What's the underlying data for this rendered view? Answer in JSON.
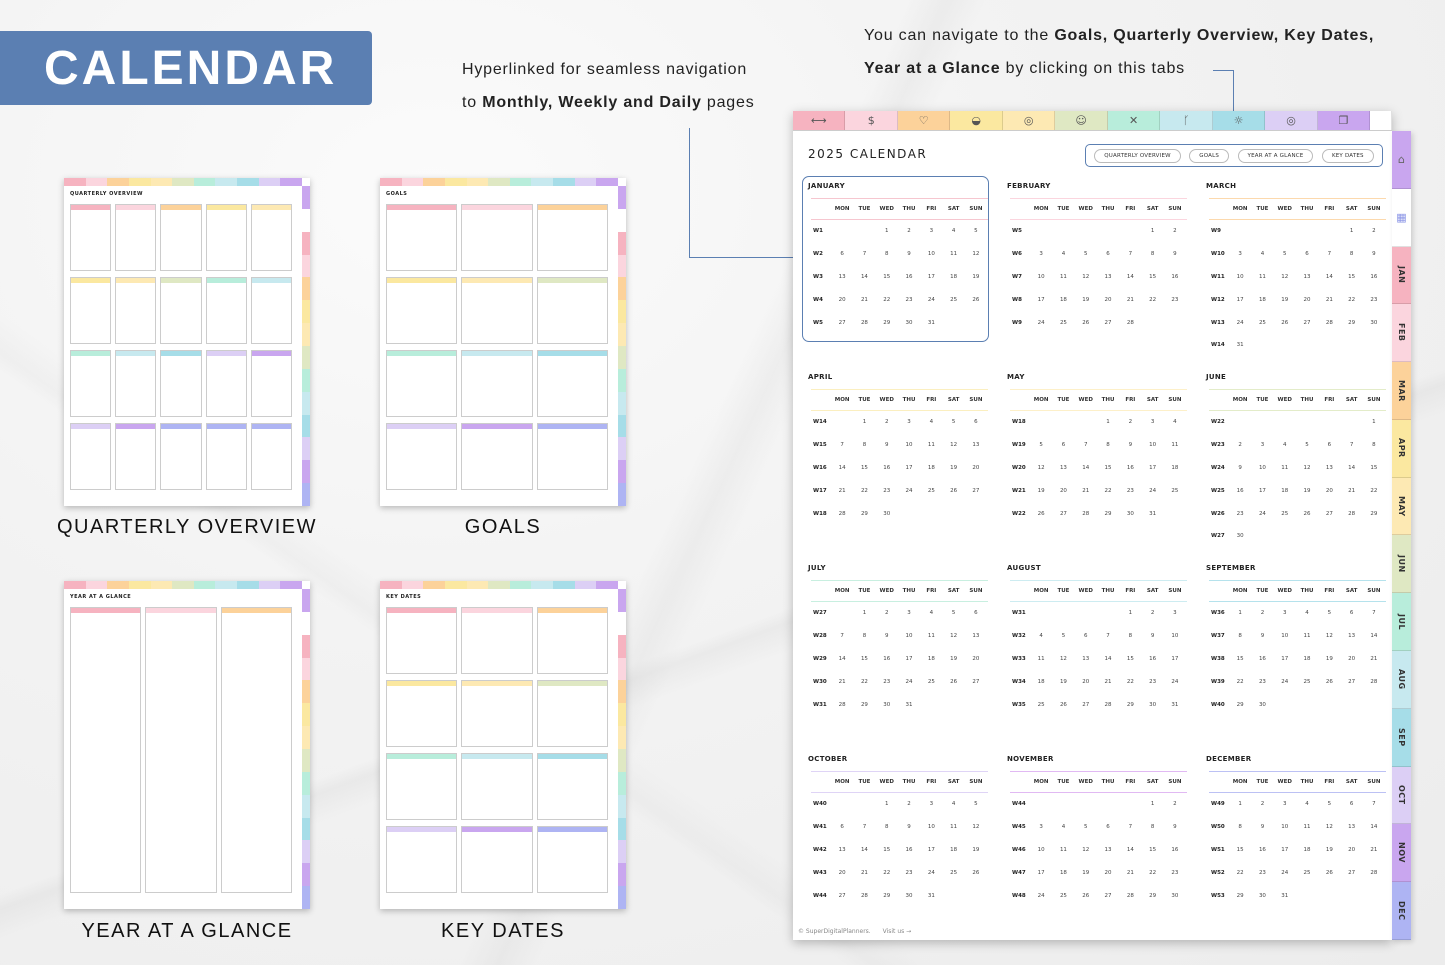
{
  "banner": {
    "title": "CALENDAR"
  },
  "notes": {
    "left": {
      "line1": "Hyperlinked for seamless navigation",
      "line2_prefix": "to ",
      "line2_bold": "Monthly, Weekly and Daily",
      "line2_suffix": " pages"
    },
    "right": {
      "line1_prefix": "You can navigate to the ",
      "line1_bold": "Goals, Quarterly Overview, Key Dates,",
      "line2_bold": "Year at a Glance",
      "line2_suffix": " by clicking on this tabs"
    }
  },
  "colors": {
    "accent": "#5b7fb2",
    "tabs": [
      "#f6b3c0",
      "#fbd5de",
      "#fcd29a",
      "#fbe8a0",
      "#fde9b3",
      "#dfe8c3",
      "#b8eddb",
      "#c7e9ef",
      "#a6dde8",
      "#dccff5",
      "#c9a6ef",
      "#aeb4f3"
    ],
    "side_tabs": [
      "#c9a6ef",
      "#ffffff",
      "#f6b3c0",
      "#fbd5de",
      "#fcd29a",
      "#fbe8a0",
      "#fde9b3",
      "#dfe8c3",
      "#b8eddb",
      "#c7e9ef",
      "#a6dde8",
      "#dccff5",
      "#c9a6ef",
      "#aeb4f3"
    ],
    "month_lines": [
      "#f6c6cf",
      "#fbd5de",
      "#fcd9ad",
      "#fbefc0",
      "#fdf0c9",
      "#e3ecc9",
      "#c8efe0",
      "#cdecf1",
      "#b5e2ec",
      "#dfd4f6",
      "#e1b9f3",
      "#bcc1f4"
    ]
  },
  "top_tabs": [
    {
      "icon": "dumbbell-icon",
      "glyph": "⟷"
    },
    {
      "icon": "money-icon",
      "glyph": "$"
    },
    {
      "icon": "heart-icon",
      "glyph": "♡"
    },
    {
      "icon": "apple-icon",
      "glyph": "◒"
    },
    {
      "icon": "chart-icon",
      "glyph": "◎"
    },
    {
      "icon": "head-icon",
      "glyph": "☺"
    },
    {
      "icon": "tools-icon",
      "glyph": "✕"
    },
    {
      "icon": "runner-icon",
      "glyph": "ᚴ"
    },
    {
      "icon": "bulb-icon",
      "glyph": "☼"
    },
    {
      "icon": "target-icon",
      "glyph": "◎"
    },
    {
      "icon": "pages-icon",
      "glyph": "❐"
    },
    {
      "icon": "blank-tab",
      "glyph": ""
    }
  ],
  "side_tabs": [
    {
      "name": "home",
      "label": "",
      "glyph": "⌂"
    },
    {
      "name": "calendar",
      "label": "",
      "glyph": "▦"
    },
    {
      "name": "jan",
      "label": "JAN"
    },
    {
      "name": "feb",
      "label": "FEB"
    },
    {
      "name": "mar",
      "label": "MAR"
    },
    {
      "name": "apr",
      "label": "APR"
    },
    {
      "name": "may",
      "label": "MAY"
    },
    {
      "name": "jun",
      "label": "JUN"
    },
    {
      "name": "jul",
      "label": "JUL"
    },
    {
      "name": "aug",
      "label": "AUG"
    },
    {
      "name": "sep",
      "label": "SEP"
    },
    {
      "name": "oct",
      "label": "OCT"
    },
    {
      "name": "nov",
      "label": "NOV"
    },
    {
      "name": "dec",
      "label": "DEC"
    }
  ],
  "page": {
    "title": "2025 CALENDAR",
    "nav": [
      "QUARTERLY OVERVIEW",
      "GOALS",
      "YEAR AT A GLANCE",
      "KEY DATES"
    ],
    "dow": [
      "MON",
      "TUE",
      "WED",
      "THU",
      "FRI",
      "SAT",
      "SUN"
    ],
    "footer": {
      "copyright": "© SuperDigitalPlanners.",
      "link": "Visit us →"
    },
    "months": [
      {
        "name": "JANUARY",
        "weeks": [
          [
            "W1",
            "",
            "",
            "1",
            "2",
            "3",
            "4",
            "5"
          ],
          [
            "W2",
            "6",
            "7",
            "8",
            "9",
            "10",
            "11",
            "12"
          ],
          [
            "W3",
            "13",
            "14",
            "15",
            "16",
            "17",
            "18",
            "19"
          ],
          [
            "W4",
            "20",
            "21",
            "22",
            "23",
            "24",
            "25",
            "26"
          ],
          [
            "W5",
            "27",
            "28",
            "29",
            "30",
            "31",
            "",
            ""
          ]
        ]
      },
      {
        "name": "FEBRUARY",
        "weeks": [
          [
            "W5",
            "",
            "",
            "",
            "",
            "",
            "1",
            "2"
          ],
          [
            "W6",
            "3",
            "4",
            "5",
            "6",
            "7",
            "8",
            "9"
          ],
          [
            "W7",
            "10",
            "11",
            "12",
            "13",
            "14",
            "15",
            "16"
          ],
          [
            "W8",
            "17",
            "18",
            "19",
            "20",
            "21",
            "22",
            "23"
          ],
          [
            "W9",
            "24",
            "25",
            "26",
            "27",
            "28",
            "",
            ""
          ]
        ]
      },
      {
        "name": "MARCH",
        "weeks": [
          [
            "W9",
            "",
            "",
            "",
            "",
            "",
            "1",
            "2"
          ],
          [
            "W10",
            "3",
            "4",
            "5",
            "6",
            "7",
            "8",
            "9"
          ],
          [
            "W11",
            "10",
            "11",
            "12",
            "13",
            "14",
            "15",
            "16"
          ],
          [
            "W12",
            "17",
            "18",
            "19",
            "20",
            "21",
            "22",
            "23"
          ],
          [
            "W13",
            "24",
            "25",
            "26",
            "27",
            "28",
            "29",
            "30"
          ],
          [
            "W14",
            "31",
            "",
            "",
            "",
            "",
            "",
            ""
          ]
        ]
      },
      {
        "name": "APRIL",
        "weeks": [
          [
            "W14",
            "",
            "1",
            "2",
            "3",
            "4",
            "5",
            "6"
          ],
          [
            "W15",
            "7",
            "8",
            "9",
            "10",
            "11",
            "12",
            "13"
          ],
          [
            "W16",
            "14",
            "15",
            "16",
            "17",
            "18",
            "19",
            "20"
          ],
          [
            "W17",
            "21",
            "22",
            "23",
            "24",
            "25",
            "26",
            "27"
          ],
          [
            "W18",
            "28",
            "29",
            "30",
            "",
            "",
            "",
            ""
          ]
        ]
      },
      {
        "name": "MAY",
        "weeks": [
          [
            "W18",
            "",
            "",
            "",
            "1",
            "2",
            "3",
            "4"
          ],
          [
            "W19",
            "5",
            "6",
            "7",
            "8",
            "9",
            "10",
            "11"
          ],
          [
            "W20",
            "12",
            "13",
            "14",
            "15",
            "16",
            "17",
            "18"
          ],
          [
            "W21",
            "19",
            "20",
            "21",
            "22",
            "23",
            "24",
            "25"
          ],
          [
            "W22",
            "26",
            "27",
            "28",
            "29",
            "30",
            "31",
            ""
          ]
        ]
      },
      {
        "name": "JUNE",
        "weeks": [
          [
            "W22",
            "",
            "",
            "",
            "",
            "",
            "",
            "1"
          ],
          [
            "W23",
            "2",
            "3",
            "4",
            "5",
            "6",
            "7",
            "8"
          ],
          [
            "W24",
            "9",
            "10",
            "11",
            "12",
            "13",
            "14",
            "15"
          ],
          [
            "W25",
            "16",
            "17",
            "18",
            "19",
            "20",
            "21",
            "22"
          ],
          [
            "W26",
            "23",
            "24",
            "25",
            "26",
            "27",
            "28",
            "29"
          ],
          [
            "W27",
            "30",
            "",
            "",
            "",
            "",
            "",
            ""
          ]
        ]
      },
      {
        "name": "JULY",
        "weeks": [
          [
            "W27",
            "",
            "1",
            "2",
            "3",
            "4",
            "5",
            "6"
          ],
          [
            "W28",
            "7",
            "8",
            "9",
            "10",
            "11",
            "12",
            "13"
          ],
          [
            "W29",
            "14",
            "15",
            "16",
            "17",
            "18",
            "19",
            "20"
          ],
          [
            "W30",
            "21",
            "22",
            "23",
            "24",
            "25",
            "26",
            "27"
          ],
          [
            "W31",
            "28",
            "29",
            "30",
            "31",
            "",
            "",
            ""
          ]
        ]
      },
      {
        "name": "AUGUST",
        "weeks": [
          [
            "W31",
            "",
            "",
            "",
            "",
            "1",
            "2",
            "3"
          ],
          [
            "W32",
            "4",
            "5",
            "6",
            "7",
            "8",
            "9",
            "10"
          ],
          [
            "W33",
            "11",
            "12",
            "13",
            "14",
            "15",
            "16",
            "17"
          ],
          [
            "W34",
            "18",
            "19",
            "20",
            "21",
            "22",
            "23",
            "24"
          ],
          [
            "W35",
            "25",
            "26",
            "27",
            "28",
            "29",
            "30",
            "31"
          ]
        ]
      },
      {
        "name": "SEPTEMBER",
        "weeks": [
          [
            "W36",
            "1",
            "2",
            "3",
            "4",
            "5",
            "6",
            "7"
          ],
          [
            "W37",
            "8",
            "9",
            "10",
            "11",
            "12",
            "13",
            "14"
          ],
          [
            "W38",
            "15",
            "16",
            "17",
            "18",
            "19",
            "20",
            "21"
          ],
          [
            "W39",
            "22",
            "23",
            "24",
            "25",
            "26",
            "27",
            "28"
          ],
          [
            "W40",
            "29",
            "30",
            "",
            "",
            "",
            "",
            ""
          ]
        ]
      },
      {
        "name": "OCTOBER",
        "weeks": [
          [
            "W40",
            "",
            "",
            "1",
            "2",
            "3",
            "4",
            "5"
          ],
          [
            "W41",
            "6",
            "7",
            "8",
            "9",
            "10",
            "11",
            "12"
          ],
          [
            "W42",
            "13",
            "14",
            "15",
            "16",
            "17",
            "18",
            "19"
          ],
          [
            "W43",
            "20",
            "21",
            "22",
            "23",
            "24",
            "25",
            "26"
          ],
          [
            "W44",
            "27",
            "28",
            "29",
            "30",
            "31",
            "",
            ""
          ]
        ]
      },
      {
        "name": "NOVEMBER",
        "weeks": [
          [
            "W44",
            "",
            "",
            "",
            "",
            "",
            "1",
            "2"
          ],
          [
            "W45",
            "3",
            "4",
            "5",
            "6",
            "7",
            "8",
            "9"
          ],
          [
            "W46",
            "10",
            "11",
            "12",
            "13",
            "14",
            "15",
            "16"
          ],
          [
            "W47",
            "17",
            "18",
            "19",
            "20",
            "21",
            "22",
            "23"
          ],
          [
            "W48",
            "24",
            "25",
            "26",
            "27",
            "28",
            "29",
            "30"
          ]
        ]
      },
      {
        "name": "DECEMBER",
        "weeks": [
          [
            "W49",
            "1",
            "2",
            "3",
            "4",
            "5",
            "6",
            "7"
          ],
          [
            "W50",
            "8",
            "9",
            "10",
            "11",
            "12",
            "13",
            "14"
          ],
          [
            "W51",
            "15",
            "16",
            "17",
            "18",
            "19",
            "20",
            "21"
          ],
          [
            "W52",
            "22",
            "23",
            "24",
            "25",
            "26",
            "27",
            "28"
          ],
          [
            "W53",
            "29",
            "30",
            "31",
            "",
            "",
            "",
            ""
          ]
        ]
      }
    ]
  },
  "thumbnails": [
    {
      "name": "quarterly-overview",
      "title": "QUARTERLY OVERVIEW",
      "caption": "QUARTERLY OVERVIEW"
    },
    {
      "name": "goals",
      "title": "GOALS",
      "caption": "GOALS"
    },
    {
      "name": "year-at-a-glance",
      "title": "YEAR AT A GLANCE",
      "caption": "YEAR AT A GLANCE"
    },
    {
      "name": "key-dates",
      "title": "KEY DATES",
      "caption": "KEY DATES"
    }
  ]
}
